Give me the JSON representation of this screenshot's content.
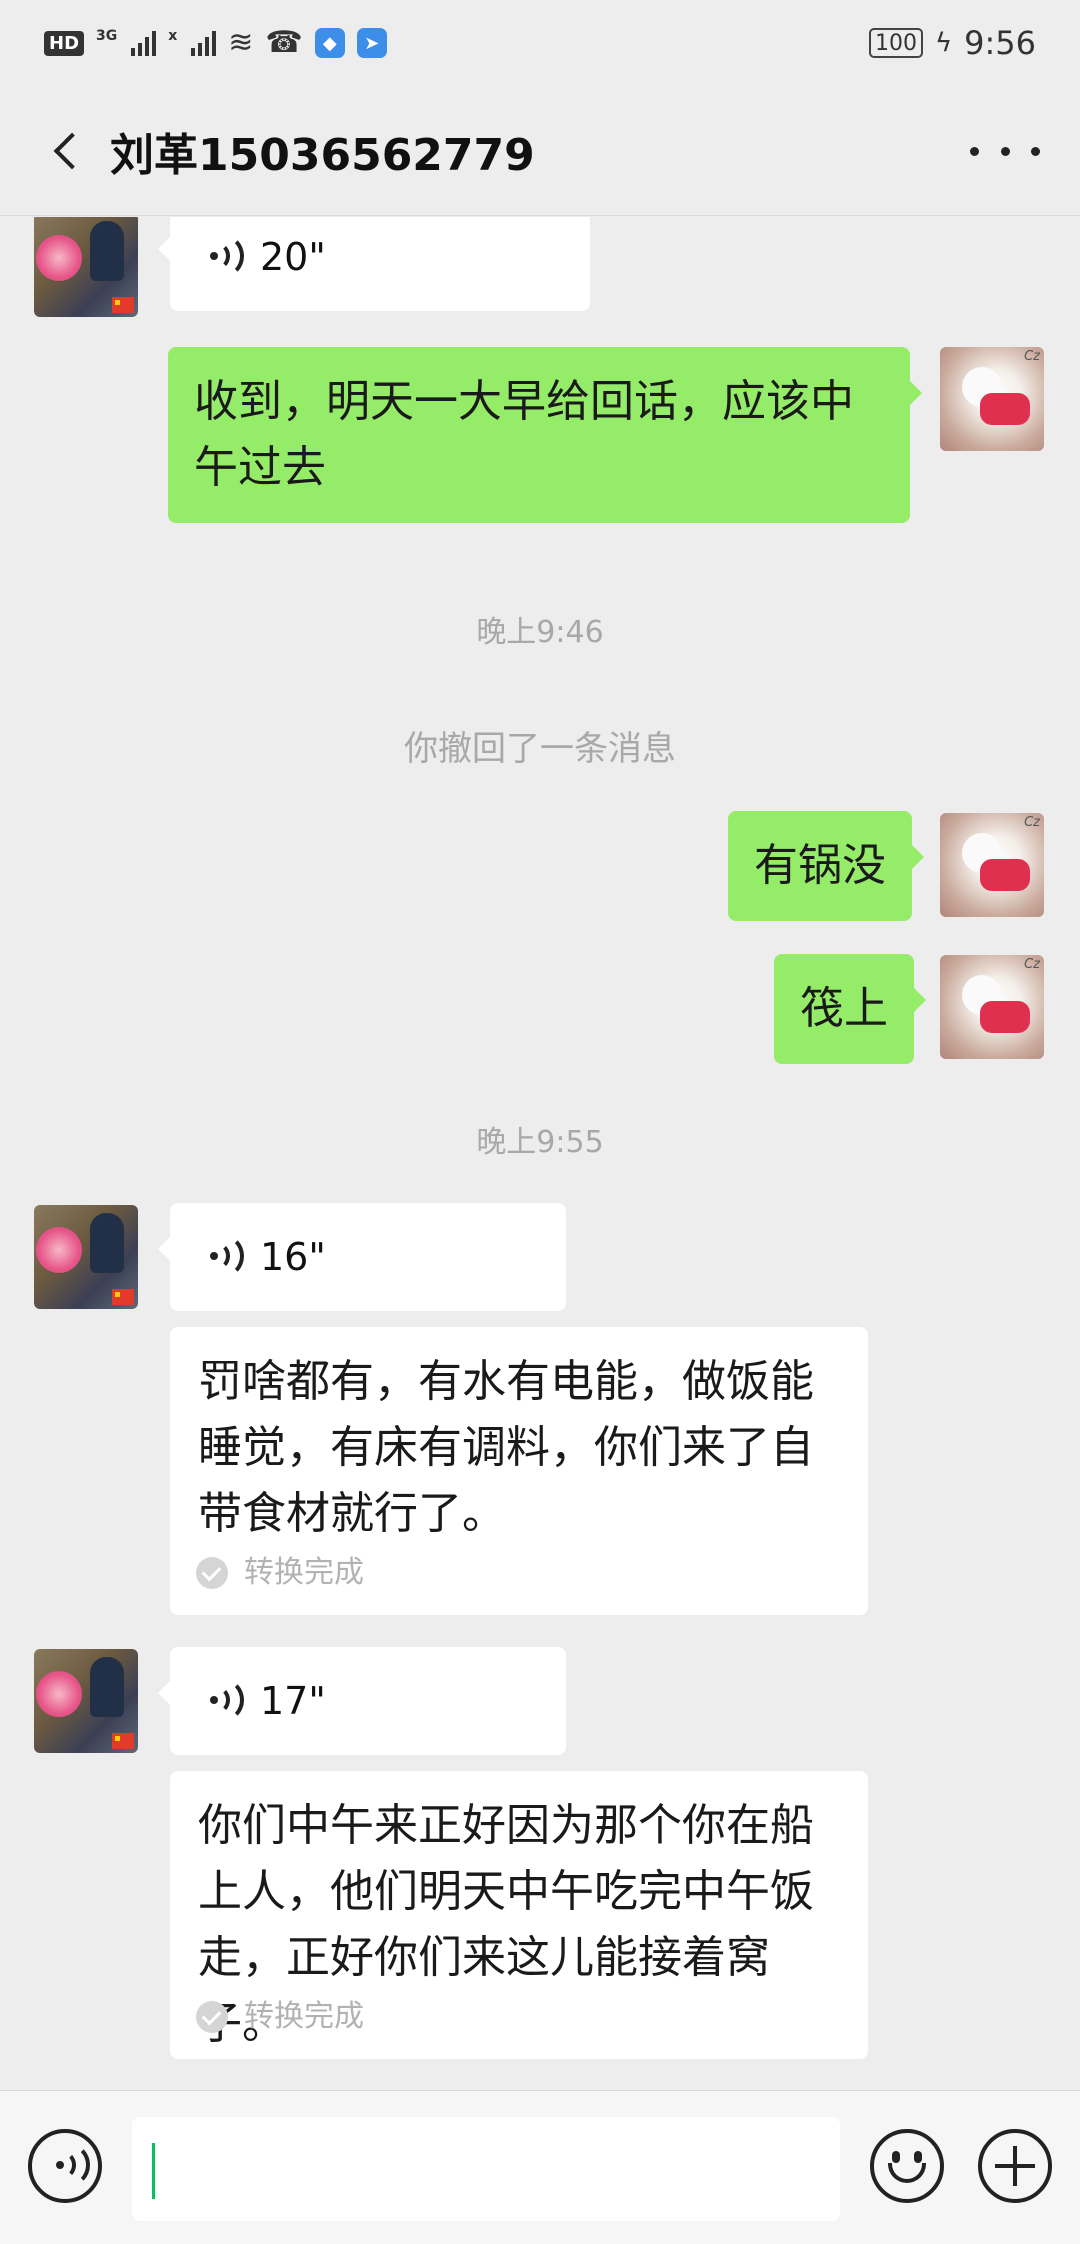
{
  "status_bar": {
    "hd": "HD",
    "signal1_label": "3G",
    "signal2_label": "x",
    "battery": "100",
    "time": "9:56"
  },
  "header": {
    "title": "刘革15036562779"
  },
  "messages": {
    "m1_voice": "20\"",
    "m2_text": "收到，明天一大早给回话，应该中午过去",
    "ts1": "晚上9:46",
    "sys1": "你撤回了一条消息",
    "m3_text": "有锅没",
    "m4_text": "筏上",
    "ts2": "晚上9:55",
    "m5_voice": "16\"",
    "m5_transcript": "罚啥都有，有水有电能，做饭能睡觉，有床有调料，你们来了自带食材就行了。",
    "m5_status": "转换完成",
    "m6_voice": "17\"",
    "m6_transcript": "你们中午来正好因为那个你在船上人，他们明天中午吃完中午饭走，正好你们来这儿能接着窝子。",
    "m6_status": "转换完成"
  },
  "colors": {
    "out_bubble": "#95ec69",
    "in_bubble": "#ffffff",
    "background": "#ededed",
    "cursor": "#07c160"
  }
}
